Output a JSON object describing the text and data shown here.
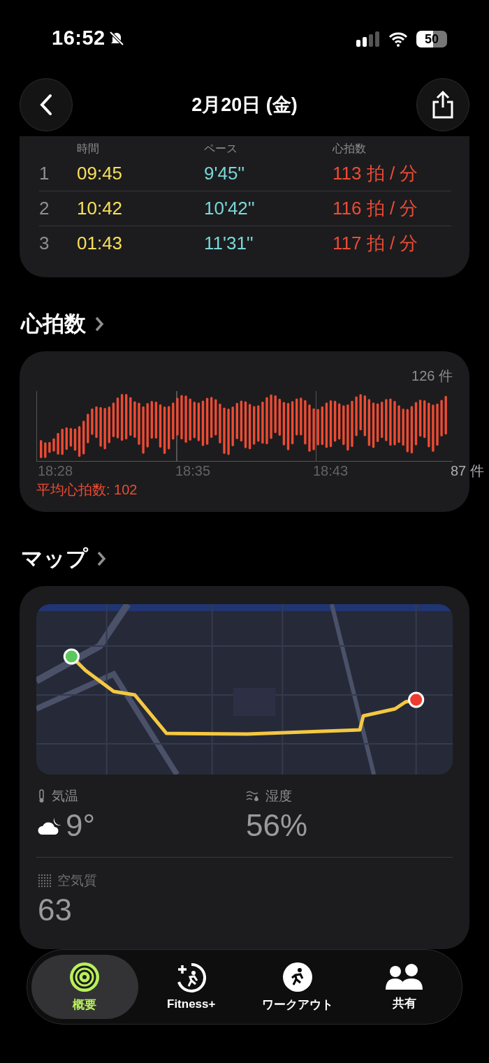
{
  "status_bar": {
    "time": "16:52",
    "silent": true,
    "battery": "50"
  },
  "nav": {
    "title": "2月20日 (金)"
  },
  "splits": {
    "columns": [
      "時間",
      "ペース",
      "心拍数"
    ],
    "rows": [
      {
        "index": "1",
        "time": "09:45",
        "pace": "9'45''",
        "heart_rate": "113 拍 / 分"
      },
      {
        "index": "2",
        "time": "10:42",
        "pace": "10'42''",
        "heart_rate": "116 拍 / 分"
      },
      {
        "index": "3",
        "time": "01:43",
        "pace": "11'31''",
        "heart_rate": "117 拍 / 分"
      }
    ]
  },
  "heart_rate": {
    "title": "心拍数",
    "max_label": "126 件",
    "min_label": "87 件",
    "x_labels": [
      "18:28",
      "18:35",
      "18:43"
    ],
    "average": "平均心拍数: 102"
  },
  "map": {
    "title": "マップ",
    "kind": "picture"
  },
  "weather": [
    {
      "kind": "temperature",
      "label": "気温",
      "value": "9°"
    },
    {
      "kind": "humidity",
      "label": "湿度",
      "value": "56%"
    },
    {
      "kind": "air_quality",
      "label": "空気質",
      "value": "63"
    }
  ],
  "tab_bar": [
    {
      "label": "概要",
      "kind": "rings",
      "selected": true
    },
    {
      "label": "Fitness+",
      "kind": "fitness",
      "selected": false
    },
    {
      "label": "ワークアウト",
      "kind": "runner",
      "selected": false
    },
    {
      "label": "共有",
      "kind": "people",
      "selected": false
    }
  ]
}
